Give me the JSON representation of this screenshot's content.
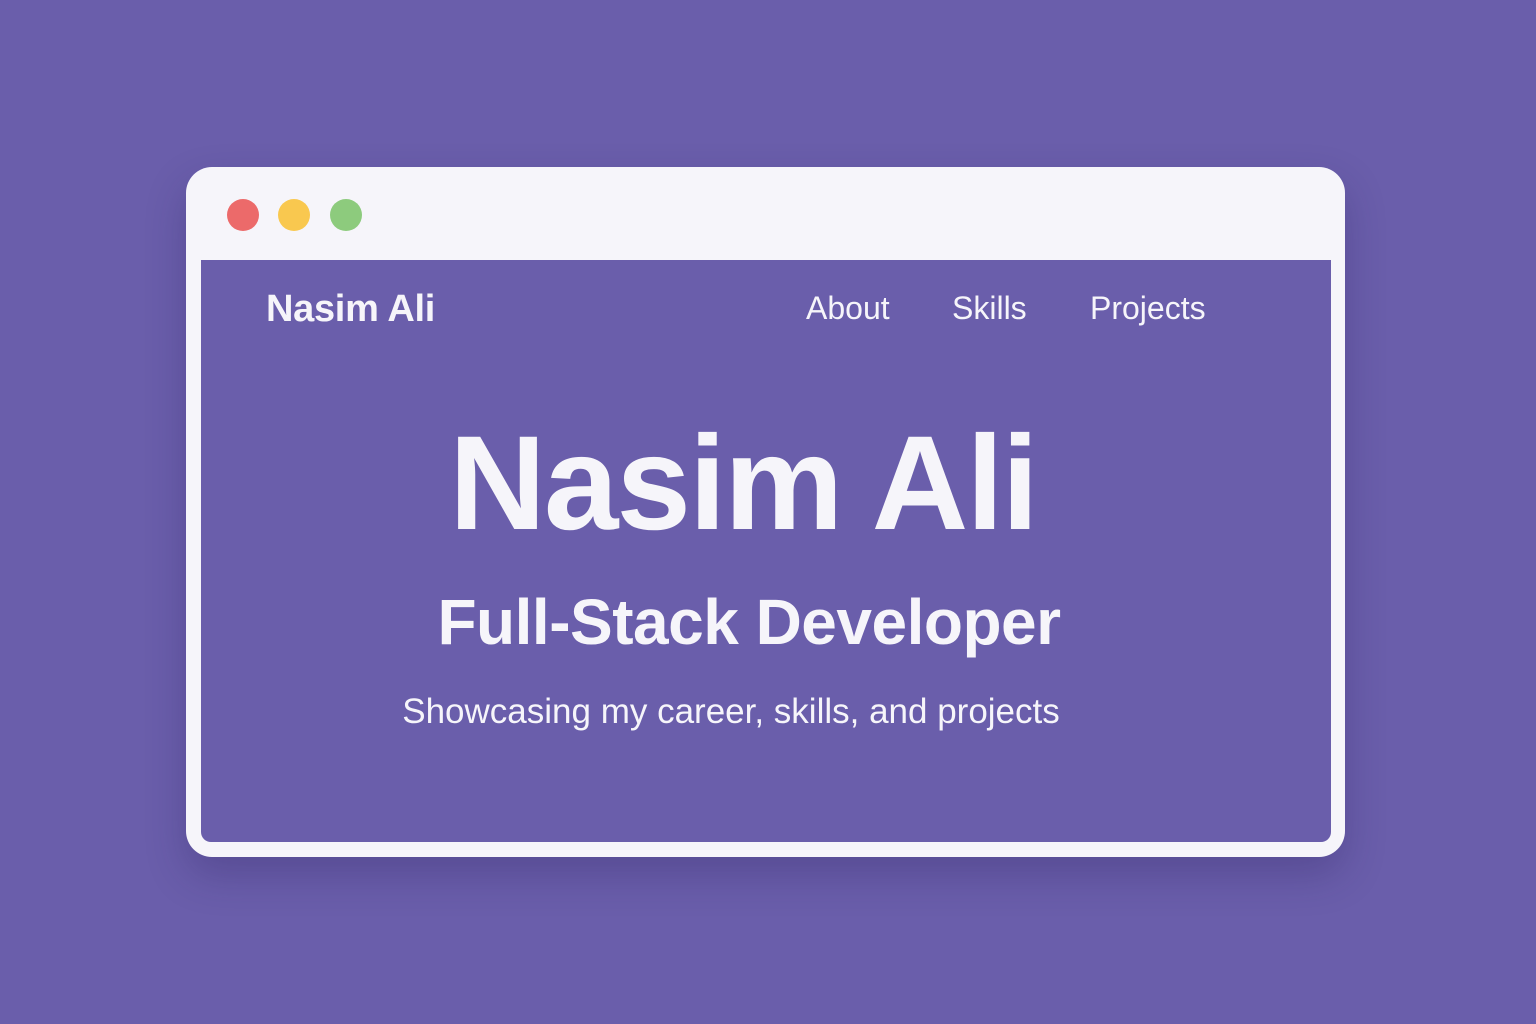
{
  "window": {
    "controls": [
      {
        "name": "close",
        "color": "#ec6a6a"
      },
      {
        "name": "minimize",
        "color": "#f9c84f"
      },
      {
        "name": "maximize",
        "color": "#8dcb7d"
      }
    ]
  },
  "colors": {
    "background": "#6a5eab",
    "window_chrome": "#f6f5fa",
    "text": "#f6f5fa"
  },
  "header": {
    "brand": "Nasim Ali",
    "nav": [
      {
        "label": "About"
      },
      {
        "label": "Skills"
      },
      {
        "label": "Projects"
      }
    ]
  },
  "hero": {
    "name": "Nasim Ali",
    "role": "Full-Stack Developer",
    "tagline": "Showcasing my career, skills, and projects"
  }
}
